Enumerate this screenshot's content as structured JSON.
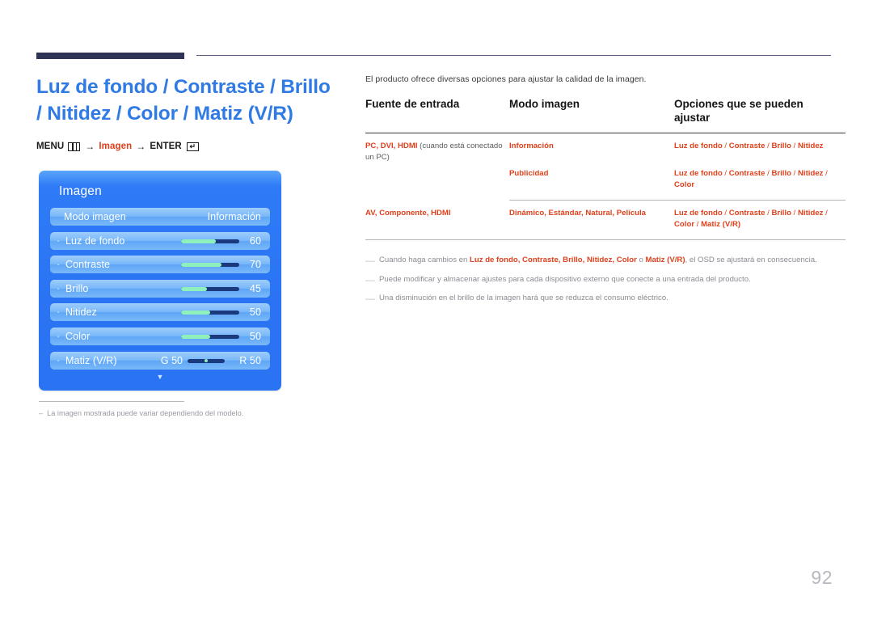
{
  "header": {
    "title": "Luz de fondo / Contraste / Brillo / Nitidez / Color / Matiz (V/R)",
    "menu_path": {
      "menu_label": "MENU",
      "menu_icon": "menu-grid-icon",
      "arrow": "→",
      "middle_label": "Imagen",
      "enter_label": "ENTER",
      "enter_icon": "enter-return-icon",
      "enter_glyph": "↵"
    }
  },
  "osd": {
    "title": "Imagen",
    "rows": [
      {
        "label": "Modo imagen",
        "value": "Información",
        "type": "text",
        "bullet": false
      },
      {
        "label": "Luz de fondo",
        "value": "60",
        "type": "slider",
        "fill_percent": 60,
        "bullet": true
      },
      {
        "label": "Contraste",
        "value": "70",
        "type": "slider",
        "fill_percent": 70,
        "bullet": true
      },
      {
        "label": "Brillo",
        "value": "45",
        "type": "slider",
        "fill_percent": 45,
        "bullet": true
      },
      {
        "label": "Nitidez",
        "value": "50",
        "type": "slider",
        "fill_percent": 50,
        "bullet": true
      },
      {
        "label": "Color",
        "value": "50",
        "type": "slider",
        "fill_percent": 50,
        "bullet": true
      },
      {
        "label": "Matiz (V/R)",
        "left_value": "G 50",
        "value": "R 50",
        "type": "dual",
        "bullet": true
      }
    ],
    "more_indicator": "▼"
  },
  "left_note": {
    "dash": "–",
    "text": "La imagen mostrada puede variar dependiendo del modelo."
  },
  "right": {
    "intro": "El producto ofrece diversas opciones para ajustar la calidad de la imagen.",
    "table": {
      "headers": [
        "Fuente de entrada",
        "Modo imagen",
        "Opciones que se pueden ajustar"
      ],
      "rows": [
        {
          "source_bold": "PC, DVI, HDMI",
          "source_plain": " (cuando está conectado un PC)",
          "mode": "Información",
          "options": "Luz de fondo / Contraste / Brillo / Nitidez"
        },
        {
          "source_bold": "",
          "source_plain": "",
          "mode": "Publicidad",
          "options": "Luz de fondo / Contraste / Brillo / Nitidez / Color"
        },
        {
          "source_bold": "AV, Componente, HDMI",
          "source_plain": "",
          "mode": "Dinámico, Estándar, Natural, Película",
          "options": "Luz de fondo / Contraste / Brillo / Nitidez / Color / Matiz (V/R)"
        }
      ]
    },
    "notes": [
      {
        "dash": "—",
        "prefix": "Cuando haga cambios en ",
        "terms": "Luz de fondo, Contraste, Brillo, Nitidez, Color",
        "mid": " o ",
        "term_last": "Matiz (V/R)",
        "suffix": ", el OSD se ajustará en consecuencia."
      },
      {
        "dash": "—",
        "text": "Puede modificar y almacenar ajustes para cada dispositivo externo que conecte a una entrada del producto."
      },
      {
        "dash": "—",
        "text": "Una disminución en el brillo de la imagen hará que se reduzca el consumo eléctrico."
      }
    ]
  },
  "page_number": "92",
  "colors": {
    "title_blue": "#2f7ae5",
    "accent_red": "#e0401b",
    "rule_navy": "#2f3356",
    "osd_blue": "#2a74f3",
    "slider_fill": "#8ef0bb",
    "slider_track": "#1b3a7e",
    "page_number_gray": "#b8b8c0"
  }
}
